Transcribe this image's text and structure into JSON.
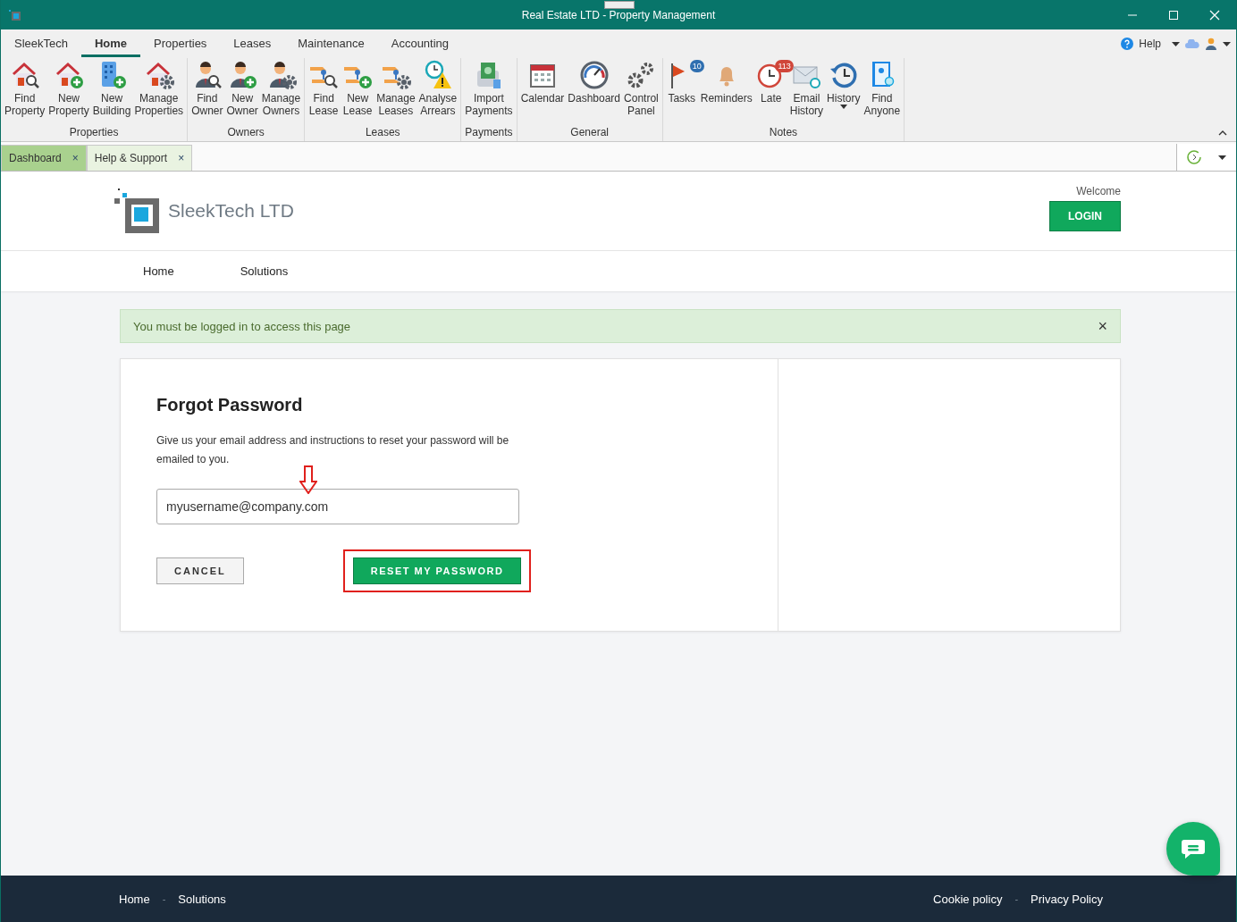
{
  "window": {
    "title": "Real Estate LTD - Property Management"
  },
  "menu_tabs": [
    {
      "label": "SleekTech",
      "selected": false
    },
    {
      "label": "Home",
      "selected": true
    },
    {
      "label": "Properties",
      "selected": false
    },
    {
      "label": "Leases",
      "selected": false
    },
    {
      "label": "Maintenance",
      "selected": false
    },
    {
      "label": "Accounting",
      "selected": false
    }
  ],
  "help": {
    "label": "Help"
  },
  "ribbon_groups": [
    {
      "title": "Properties",
      "buttons": [
        {
          "label": "Find\nProperty"
        },
        {
          "label": "New\nProperty"
        },
        {
          "label": "New\nBuilding"
        },
        {
          "label": "Manage\nProperties"
        }
      ]
    },
    {
      "title": "Owners",
      "buttons": [
        {
          "label": "Find\nOwner"
        },
        {
          "label": "New\nOwner"
        },
        {
          "label": "Manage\nOwners"
        }
      ]
    },
    {
      "title": "Leases",
      "buttons": [
        {
          "label": "Find\nLease"
        },
        {
          "label": "New\nLease"
        },
        {
          "label": "Manage\nLeases"
        },
        {
          "label": "Analyse\nArrears"
        }
      ]
    },
    {
      "title": "Payments",
      "buttons": [
        {
          "label": "Import\nPayments"
        }
      ]
    },
    {
      "title": "General",
      "buttons": [
        {
          "label": "Calendar"
        },
        {
          "label": "Dashboard"
        },
        {
          "label": "Control\nPanel"
        }
      ]
    },
    {
      "title": "Notes",
      "buttons": [
        {
          "label": "Tasks",
          "badge": "10"
        },
        {
          "label": "Reminders"
        },
        {
          "label": "Late",
          "badge": "113"
        },
        {
          "label": "Email\nHistory"
        },
        {
          "label": "History",
          "dropdown": true
        },
        {
          "label": "Find\nAnyone"
        }
      ]
    }
  ],
  "doc_tabs": [
    {
      "label": "Dashboard",
      "close": "×",
      "selected": false
    },
    {
      "label": "Help & Support",
      "close": "×",
      "selected": true
    }
  ],
  "site": {
    "brand": "SleekTech LTD",
    "welcome": "Welcome",
    "login": "LOGIN",
    "nav": [
      "Home",
      "Solutions"
    ]
  },
  "alert": {
    "text": "You must be logged in to access this page",
    "close": "×"
  },
  "form": {
    "title": "Forgot Password",
    "description": "Give us your email address and instructions to reset your password will be emailed to you.",
    "email": "myusername@company.com",
    "cancel": "CANCEL",
    "submit": "RESET MY PASSWORD"
  },
  "footer": {
    "left": [
      "Home",
      "Solutions"
    ],
    "right": [
      "Cookie policy",
      "Privacy Policy"
    ],
    "separator": "-"
  }
}
